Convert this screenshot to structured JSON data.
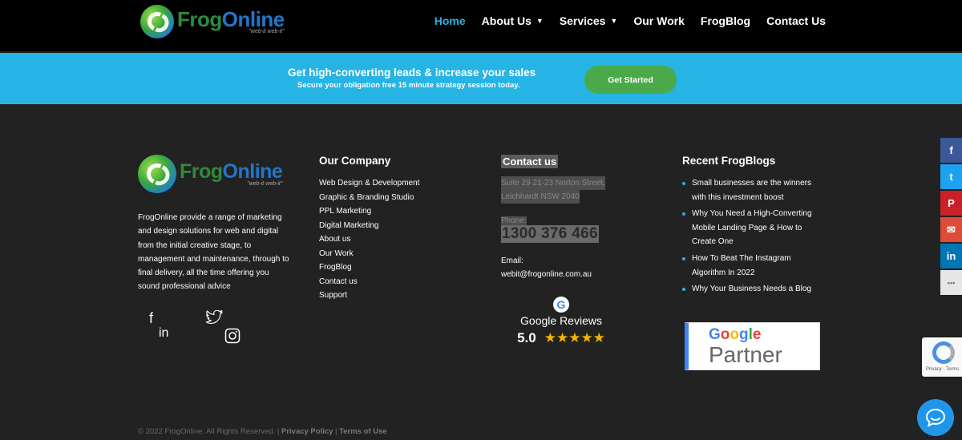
{
  "header": {
    "logo_word_green": "Frog",
    "logo_word_blue": "Online",
    "logo_tagline": "\"web-it web-it\"",
    "nav": [
      {
        "label": "Home",
        "active": true,
        "has_dropdown": false
      },
      {
        "label": "About Us",
        "active": false,
        "has_dropdown": true
      },
      {
        "label": "Services",
        "active": false,
        "has_dropdown": true
      },
      {
        "label": "Our Work",
        "active": false,
        "has_dropdown": false
      },
      {
        "label": "FrogBlog",
        "active": false,
        "has_dropdown": false
      },
      {
        "label": "Contact Us",
        "active": false,
        "has_dropdown": false
      }
    ]
  },
  "banner": {
    "title": "Get high-converting leads & increase your sales",
    "subtitle": "Secure your obligation free 15 minute strategy session today.",
    "cta_label": "Get Started"
  },
  "footer": {
    "about_text": "FrogOnline provide a range of marketing and design solutions for web and digital from the initial creative stage, to management and maintenance, through to final delivery, all the time offering you sound professional advice",
    "company": {
      "heading": "Our Company",
      "links": [
        "Web Design & Development",
        "Graphic & Branding Studio",
        "PPL Marketing",
        "Digital Marketing",
        "About us",
        "Our Work",
        "FrogBlog",
        "Contact us",
        "Support"
      ]
    },
    "contact": {
      "heading": "Contact us",
      "address_line1": "Suite 29 21-23 Norton Street,",
      "address_line2": "Leichhardt NSW 2040",
      "phone_label": "Phone:",
      "phone": "1300 376 466",
      "email_label": "Email:",
      "email": "webit@frogonline.com.au"
    },
    "reviews": {
      "g_letter": "G",
      "title": "Google Reviews",
      "score": "5.0",
      "stars": "★★★★★"
    },
    "blogs": {
      "heading": "Recent FrogBlogs",
      "items": [
        "Small businesses are the winners with this investment boost",
        "Why You Need a High-Converting Mobile Landing Page & How to Create One",
        "How To Beat The Instagram Algorithm In 2022",
        "Why Your Business Needs a Blog"
      ]
    },
    "partner": {
      "google_word": "Google",
      "partner_word": "Partner"
    },
    "copyright": "© 2022 FrogOnline. All Rights Reserved. |",
    "privacy_label": "Privacy Policy",
    "terms_label": "Terms of Use"
  },
  "share_bar": {
    "icons": [
      "facebook-icon",
      "twitter-icon",
      "pinterest-icon",
      "email-icon",
      "linkedin-icon",
      "more-icon"
    ],
    "glyphs": [
      "f",
      "t",
      "P",
      "✉",
      "in",
      "•••"
    ],
    "colors": [
      "#3b5998",
      "#1da1f2",
      "#cb2027",
      "#dd4b39",
      "#0077b5",
      "#e6e6e6"
    ]
  },
  "recaptcha": {
    "text": "Privacy - Terms"
  },
  "colors": {
    "accent": "#2ab1e6",
    "banner_bg": "#26b4e4",
    "cta_bg": "#4aaa4a",
    "footer_bg": "#222222",
    "star": "#f5b301"
  }
}
